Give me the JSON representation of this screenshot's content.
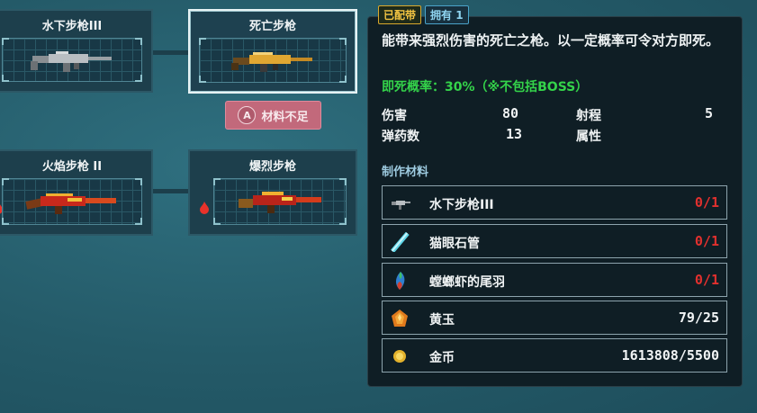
{
  "tree": {
    "nodes": [
      {
        "name": "水下步枪III"
      },
      {
        "name": "死亡步枪"
      },
      {
        "name": "火焰步枪 II"
      },
      {
        "name": "爆烈步枪"
      }
    ],
    "insufficient_button": {
      "badge": "A",
      "label": "材料不足"
    }
  },
  "detail": {
    "badges": {
      "equipped": "已配带",
      "owned": "拥有 1"
    },
    "description": "能带来强烈伤害的死亡之枪。以一定概率可令对方即死。",
    "instant_kill": "即死概率：30%（※不包括BOSS）",
    "stats": {
      "damage_label": "伤害",
      "damage_value": "80",
      "range_label": "射程",
      "range_value": "5",
      "ammo_label": "弹药数",
      "ammo_value": "13",
      "attribute_label": "属性",
      "attribute_value": ""
    },
    "materials_title": "制作材料",
    "materials": [
      {
        "name": "水下步枪III",
        "count": "0/1",
        "icon": "rifle-icon",
        "sufficient": false
      },
      {
        "name": "猫眼石管",
        "count": "0/1",
        "icon": "tube-icon",
        "sufficient": false
      },
      {
        "name": "螳螂虾的尾羽",
        "count": "0/1",
        "icon": "feather-icon",
        "sufficient": false
      },
      {
        "name": "黄玉",
        "count": "79/25",
        "icon": "topaz-icon",
        "sufficient": true
      },
      {
        "name": "金币",
        "count": "1613808/5500",
        "icon": "coin-icon",
        "sufficient": true
      }
    ]
  },
  "colors": {
    "background": "#245a68",
    "panel": "#0f1e25",
    "insufficient": "#e2302e",
    "chance": "#34d34a",
    "button": "#c2697b"
  }
}
